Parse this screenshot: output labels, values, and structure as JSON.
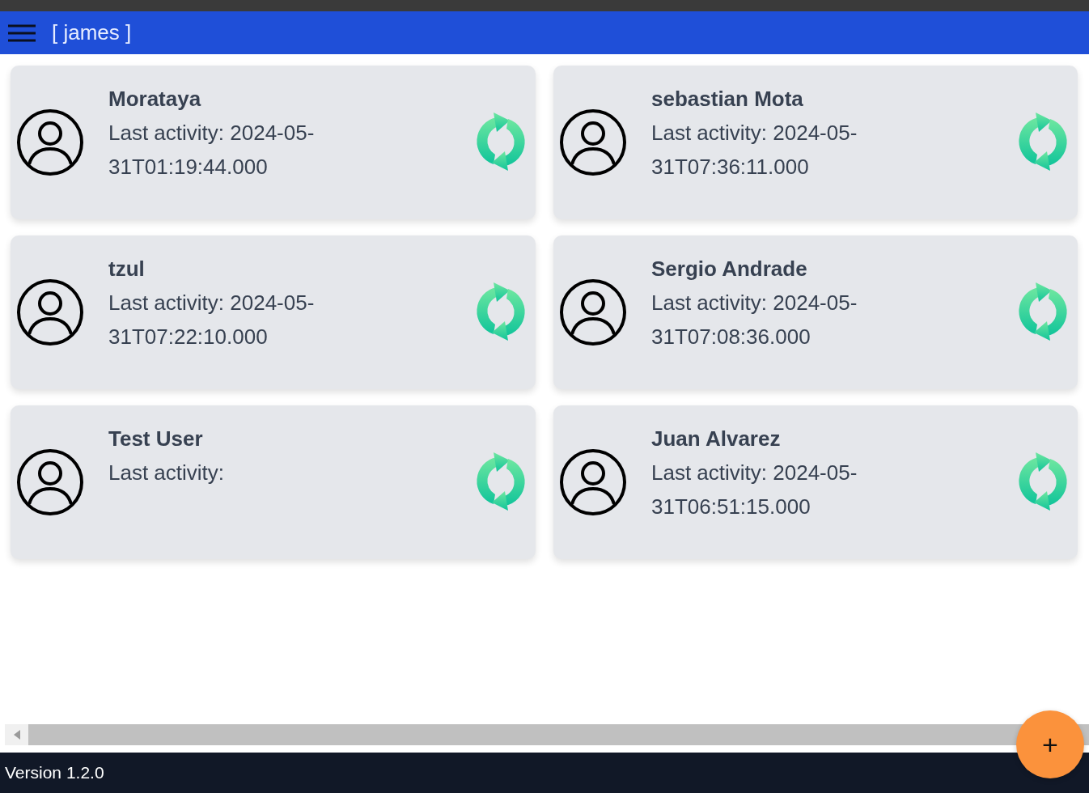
{
  "header": {
    "title": "[ james ]"
  },
  "users": [
    {
      "name": "Morataya",
      "activity": "Last activity: 2024-05-31T01:19:44.000"
    },
    {
      "name": "sebastian Mota",
      "activity": "Last activity: 2024-05-31T07:36:11.000"
    },
    {
      "name": "tzul",
      "activity": "Last activity: 2024-05-31T07:22:10.000"
    },
    {
      "name": "Sergio Andrade",
      "activity": "Last activity: 2024-05-31T07:08:36.000"
    },
    {
      "name": "Test User",
      "activity": "Last activity:"
    },
    {
      "name": "Juan Alvarez",
      "activity": "Last activity: 2024-05-31T06:51:15.000"
    }
  ],
  "add_button": "+",
  "footer": {
    "version": "Version 1.2.0"
  }
}
